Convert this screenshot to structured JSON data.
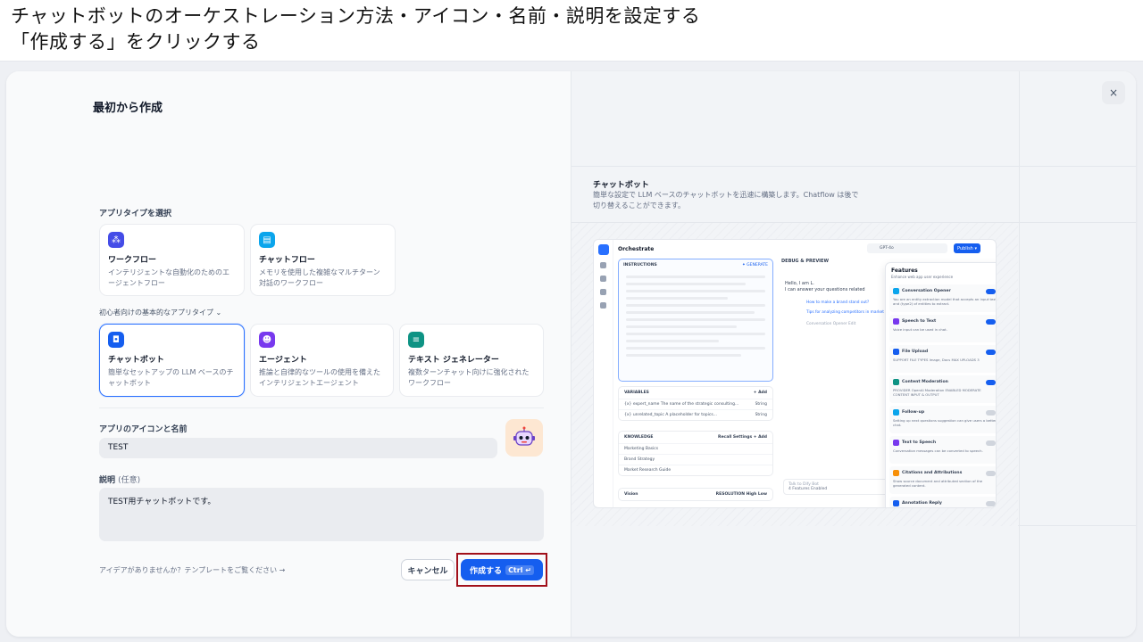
{
  "slide": {
    "line1": "チャットボットのオーケストレーション方法・アイコン・名前・説明を設定する",
    "line2": "「作成する」をクリックする"
  },
  "form": {
    "title": "最初から作成",
    "select_type_label": "アプリタイプを選択",
    "types_top": [
      {
        "name": "ワークフロー",
        "desc": "インテリジェントな自動化のためのエージェントフロー",
        "color": "#444ce7"
      },
      {
        "name": "チャットフロー",
        "desc": "メモリを使用した複雑なマルチターン対話のワークフロー",
        "color": "#0ba5ec"
      }
    ],
    "beginner_toggle": "初心者向けの基本的なアプリタイプ",
    "types_basic": [
      {
        "name": "チャットボット",
        "desc": "簡単なセットアップの LLM ベースのチャットボット",
        "color": "#155eef",
        "selected": true
      },
      {
        "name": "エージェント",
        "desc": "推論と自律的なツールの使用を備えたインテリジェントエージェント",
        "color": "#7839ee"
      },
      {
        "name": "テキスト ジェネレーター",
        "desc": "複数ターンチャット向けに強化されたワークフロー",
        "color": "#0e9384"
      }
    ],
    "icon_name_label": "アプリのアイコンと名前",
    "name_value": "TEST",
    "desc_label": "説明",
    "desc_optional": "(任意)",
    "desc_value": "TEST用チャットボットです。",
    "idea_link": "アイデアがありませんか？テンプレートをご覧ください →",
    "cancel": "キャンセル",
    "create": "作成する",
    "create_kbd": "Ctrl ↵"
  },
  "preview": {
    "close_icon": "×",
    "title": "チャットボット",
    "desc": "簡単な設定で LLM ベースのチャットボットを迅速に構築します。Chatflow は後で切り替えることができます。",
    "mock": {
      "header": "Orchestrate",
      "model": "GPT-4o",
      "publish": "Publish ▾",
      "instructions": "INSTRUCTIONS",
      "generate": "✦ GENERATE",
      "variables": "VARIABLES",
      "add": "+ Add",
      "vars": [
        {
          "name": "{x} expert_name",
          "desc": "The name of the strategic consulting...",
          "type": "String"
        },
        {
          "name": "{x} unrelated_topic",
          "desc": "A placeholder for topics...",
          "type": "String"
        }
      ],
      "knowledge": "KNOWLEDGE",
      "recall": "Recall Settings",
      "kb": [
        "Marketing Basics",
        "Brand Strategy",
        "Market Research Guide"
      ],
      "vision": "Vision",
      "resolution": "RESOLUTION",
      "high": "High",
      "low": "Low",
      "debug": "DEBUG & PREVIEW",
      "hello": "Hello, I am L.",
      "answer": "I can answer your questions related",
      "q1": "How to make a brand stand out?",
      "q2": "Tips for analyzing competitors in market",
      "opener_note": "Conversation Opener  Edit",
      "talk_placeholder": "Talk to Dify Bot",
      "features_enabled": "4 Features Enabled",
      "features_title": "Features",
      "features_sub": "Enhance web app user experience",
      "features": [
        {
          "name": "Conversation Opener",
          "desc": "You are an entity extraction model that accepts an input text and (type2) of entities to extract.",
          "on": true,
          "color": "#0ba5ec"
        },
        {
          "name": "Speech to Text",
          "desc": "Voice input can be used in chat.",
          "on": true,
          "color": "#7839ee"
        },
        {
          "name": "File Upload",
          "desc": "SUPPORT FILE TYPES  Image, Docs   MAX UPLOADS 3",
          "on": true,
          "color": "#155eef"
        },
        {
          "name": "Content Moderation",
          "desc": "PROVIDER OpenAI Moderation   ENABLED MODERATE CONTENT INPUT & OUTPUT",
          "on": true,
          "color": "#0e9384"
        },
        {
          "name": "Follow-up",
          "desc": "Setting up next questions suggestion can give users a better chat.",
          "on": false,
          "color": "#0ba5ec"
        },
        {
          "name": "Text to Speech",
          "desc": "Conversation messages can be converted to speech.",
          "on": false,
          "color": "#7839ee"
        },
        {
          "name": "Citations and Attributions",
          "desc": "Show source document and attributed section of the generated content.",
          "on": false,
          "color": "#f79009"
        },
        {
          "name": "Annotation Reply",
          "desc": "",
          "on": false,
          "color": "#155eef"
        }
      ]
    }
  }
}
